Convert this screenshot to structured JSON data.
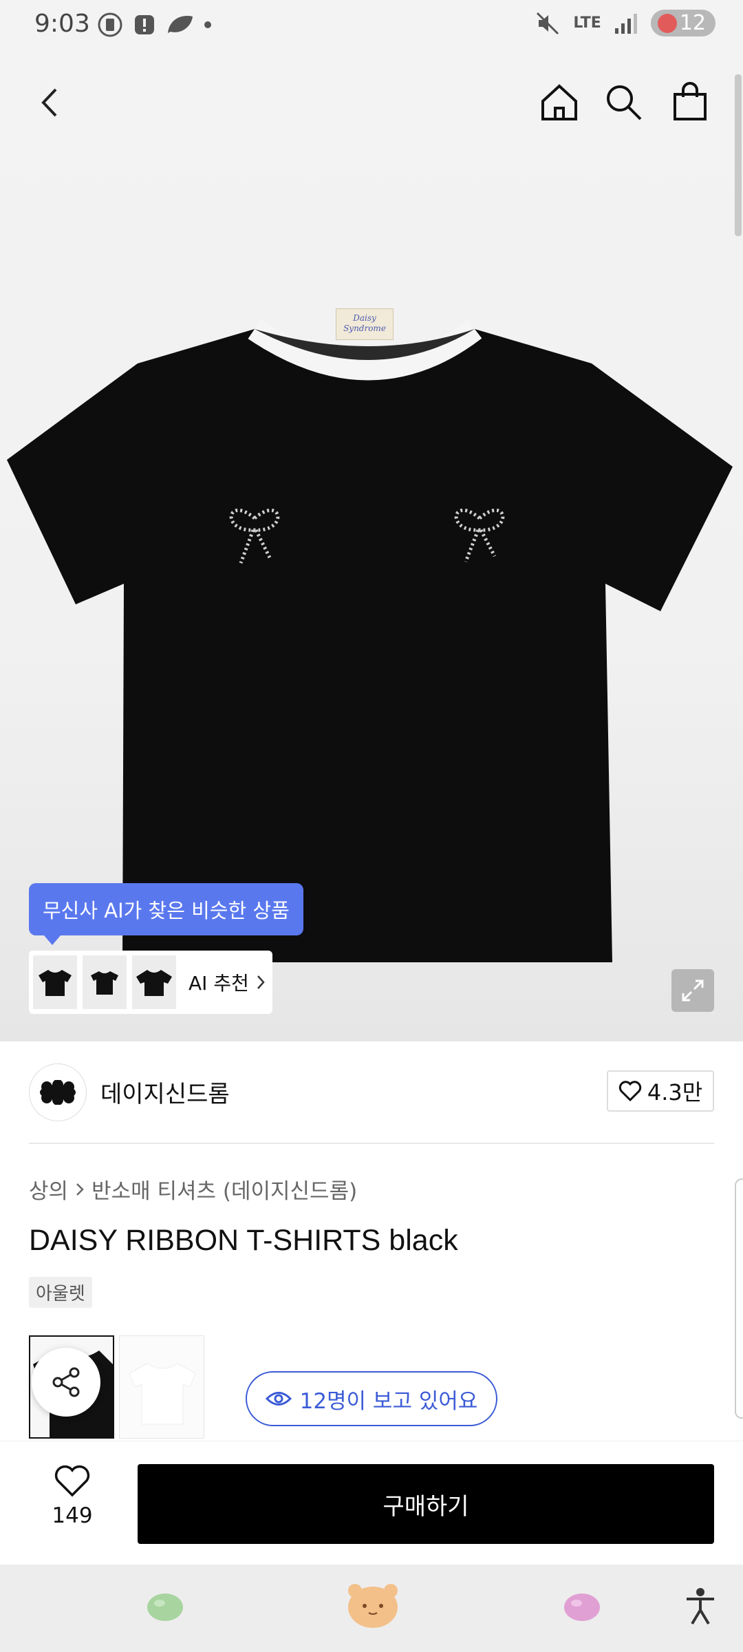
{
  "status_bar": {
    "time": "9:03",
    "network": "LTE",
    "battery": "12"
  },
  "product_image": {
    "neck_label": "Daisy Syndrome"
  },
  "ai": {
    "tooltip": "무신사 AI가 찾은 비슷한 상품",
    "label": "AI 추천"
  },
  "brand": {
    "name": "데이지신드롬",
    "likes": "4.3만"
  },
  "breadcrumb": {
    "category": "상의",
    "subcategory": "반소매 티셔츠 (데이지신드롬)"
  },
  "product": {
    "title": "DAISY RIBBON T-SHIRTS black",
    "tag": "아울렛"
  },
  "viewers": "12명이 보고 있어요",
  "purchase": {
    "wish_count": "149",
    "buy_label": "구매하기"
  },
  "colors": {
    "accent": "#5a78ee",
    "viewer_blue": "#3b5bd6",
    "buy_button": "#000000"
  }
}
